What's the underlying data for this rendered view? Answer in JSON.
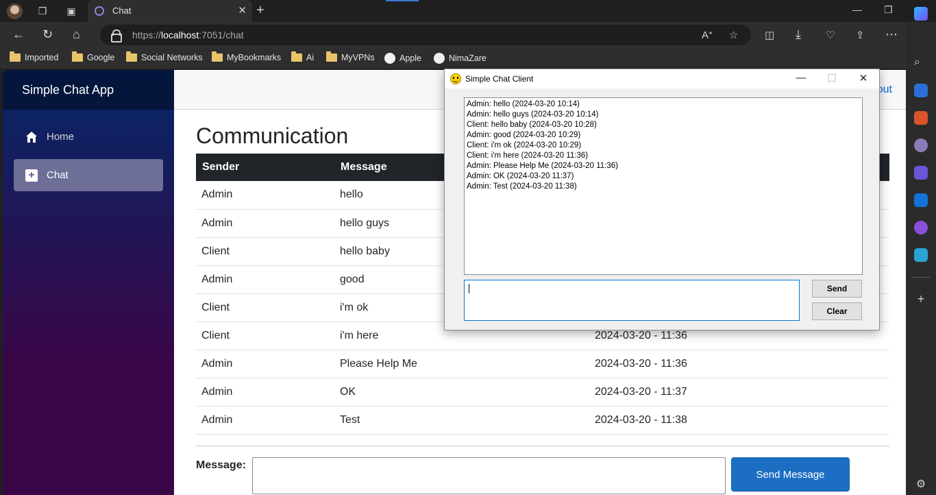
{
  "browser": {
    "tab_title": "Chat",
    "url_scheme": "https://",
    "url_host": "localhost",
    "url_rest": ":7051/chat",
    "bookmarks": [
      {
        "label": "Imported",
        "icon": "folder-icon"
      },
      {
        "label": "Google",
        "icon": "folder-icon"
      },
      {
        "label": "Social Networks",
        "icon": "folder-icon"
      },
      {
        "label": "MyBookmarks",
        "icon": "folder-icon"
      },
      {
        "label": "Ai",
        "icon": "folder-icon"
      },
      {
        "label": "MyVPNs",
        "icon": "folder-icon"
      },
      {
        "label": "Apple",
        "icon": "apple-icon"
      },
      {
        "label": "NimaZare",
        "icon": "github-icon"
      }
    ]
  },
  "app": {
    "brand": "Simple Chat App",
    "nav": [
      {
        "label": "Home",
        "icon": "home-icon"
      },
      {
        "label": "Chat",
        "icon": "plus-icon"
      }
    ],
    "top_link": "out",
    "heading": "Communication",
    "table": {
      "headers": [
        "Sender",
        "Message"
      ],
      "rows": [
        {
          "sender": "Admin",
          "message": "hello",
          "time": ""
        },
        {
          "sender": "Admin",
          "message": "hello guys",
          "time": ""
        },
        {
          "sender": "Client",
          "message": "hello baby",
          "time": ""
        },
        {
          "sender": "Admin",
          "message": "good",
          "time": ""
        },
        {
          "sender": "Client",
          "message": "i'm ok",
          "time": ""
        },
        {
          "sender": "Client",
          "message": "i'm here",
          "time": "2024-03-20 - 11:36"
        },
        {
          "sender": "Admin",
          "message": "Please Help Me",
          "time": "2024-03-20 - 11:36"
        },
        {
          "sender": "Admin",
          "message": "OK",
          "time": "2024-03-20 - 11:37"
        },
        {
          "sender": "Admin",
          "message": "Test",
          "time": "2024-03-20 - 11:38"
        }
      ]
    },
    "message_label": "Message:",
    "message_value": "",
    "send_label": "Send Message"
  },
  "dialog": {
    "title": "Simple Chat Client",
    "lines": [
      "Admin: hello (2024-03-20 10:14)",
      "Admin: hello guys (2024-03-20 10:14)",
      "Client: hello baby (2024-03-20 10:28)",
      "Admin: good (2024-03-20 10:29)",
      "Client: i'm ok (2024-03-20 10:29)",
      "Client: i'm here (2024-03-20 11:36)",
      "Admin: Please Help Me (2024-03-20 11:36)",
      "Admin: OK (2024-03-20 11:37)",
      "Admin: Test (2024-03-20 11:38)"
    ],
    "input_value": "",
    "send_label": "Send",
    "clear_label": "Clear"
  }
}
